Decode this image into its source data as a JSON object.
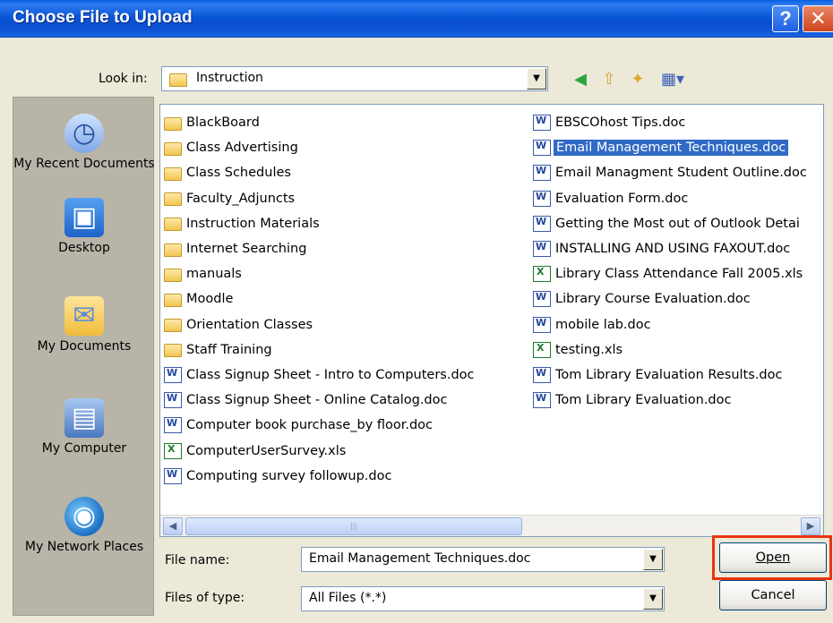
{
  "window": {
    "title": "Choose File to Upload",
    "help_glyph": "?",
    "close_glyph": "✕"
  },
  "toolbar": {
    "look_in_label": "Look in:",
    "look_in_value": "Instruction",
    "icons": [
      "back-icon",
      "up-folder-icon",
      "new-folder-icon",
      "view-menu-icon"
    ]
  },
  "places": [
    {
      "id": "recent",
      "label": "My Recent Documents",
      "icon": "recent-documents-icon"
    },
    {
      "id": "desktop",
      "label": "Desktop",
      "icon": "desktop-icon"
    },
    {
      "id": "documents",
      "label": "My Documents",
      "icon": "my-documents-icon"
    },
    {
      "id": "computer",
      "label": "My Computer",
      "icon": "my-computer-icon"
    },
    {
      "id": "network",
      "label": "My Network Places",
      "icon": "network-places-icon"
    }
  ],
  "files": {
    "column1": [
      {
        "name": "BlackBoard",
        "type": "folder"
      },
      {
        "name": "Class Advertising",
        "type": "folder"
      },
      {
        "name": "Class Schedules",
        "type": "folder"
      },
      {
        "name": "Faculty_Adjuncts",
        "type": "folder"
      },
      {
        "name": "Instruction Materials",
        "type": "folder"
      },
      {
        "name": "Internet Searching",
        "type": "folder"
      },
      {
        "name": "manuals",
        "type": "folder"
      },
      {
        "name": "Moodle",
        "type": "folder"
      },
      {
        "name": "Orientation Classes",
        "type": "folder"
      },
      {
        "name": "Staff Training",
        "type": "folder"
      },
      {
        "name": "Class Signup Sheet - Intro to Computers.doc",
        "type": "word"
      },
      {
        "name": "Class Signup Sheet - Online Catalog.doc",
        "type": "word"
      },
      {
        "name": "Computer book purchase_by floor.doc",
        "type": "word"
      },
      {
        "name": "ComputerUserSurvey.xls",
        "type": "excel"
      },
      {
        "name": "Computing survey followup.doc",
        "type": "word"
      }
    ],
    "column2": [
      {
        "name": "EBSCOhost Tips.doc",
        "type": "word"
      },
      {
        "name": "Email Management Techniques.doc",
        "type": "word",
        "selected": true
      },
      {
        "name": "Email Managment Student Outline.doc",
        "type": "word"
      },
      {
        "name": "Evaluation Form.doc",
        "type": "word"
      },
      {
        "name": "Getting the Most out of Outlook Detai",
        "type": "word"
      },
      {
        "name": "INSTALLING AND USING FAXOUT.doc",
        "type": "word"
      },
      {
        "name": "Library Class Attendance Fall 2005.xls",
        "type": "excel"
      },
      {
        "name": "Library Course Evaluation.doc",
        "type": "word"
      },
      {
        "name": "mobile lab.doc",
        "type": "word"
      },
      {
        "name": "testing.xls",
        "type": "excel"
      },
      {
        "name": "Tom Library Evaluation Results.doc",
        "type": "word"
      },
      {
        "name": "Tom Library Evaluation.doc",
        "type": "word"
      }
    ]
  },
  "form": {
    "file_name_label": "File name:",
    "file_name_value": "Email Management Techniques.doc",
    "file_type_label": "Files of type:",
    "file_type_value": "All Files (*.*)",
    "open_label": "Open",
    "cancel_label": "Cancel"
  },
  "colors": {
    "title_bar": "#0b58d8",
    "selection": "#316ac5",
    "highlight_box": "#e8350f"
  }
}
